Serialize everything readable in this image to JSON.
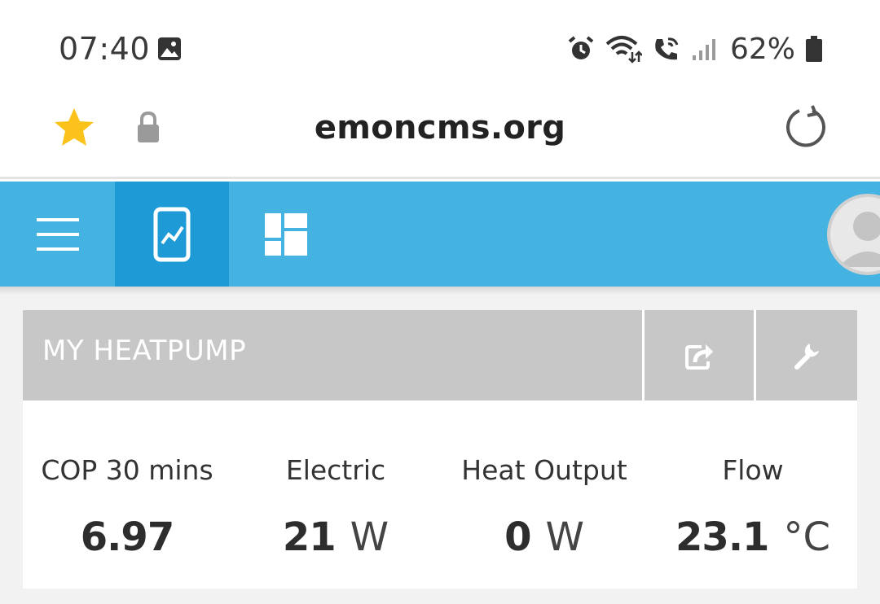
{
  "status_bar": {
    "time": "07:40",
    "battery_percent": "62%",
    "icons": [
      "gallery-icon",
      "alarm-icon",
      "wifi-icon",
      "wifi-call-icon",
      "signal-icon",
      "battery-icon"
    ]
  },
  "browser": {
    "url": "emoncms.org",
    "icons": [
      "star-icon",
      "lock-icon",
      "reload-icon"
    ]
  },
  "app_nav": {
    "icons": [
      "hamburger-menu-icon",
      "graph-icon",
      "dashboard-icon",
      "user-avatar-icon"
    ],
    "active": "graph",
    "colors": {
      "bar": "#44b3e2",
      "active": "#1e9bd7"
    }
  },
  "panel": {
    "title": "MY HEATPUMP",
    "header_color": "#c7c7c7",
    "actions": [
      "share-icon",
      "wrench-icon"
    ],
    "metrics": [
      {
        "label": "COP 30 mins",
        "value": "6.97",
        "unit": ""
      },
      {
        "label": "Electric",
        "value": "21",
        "unit": "W"
      },
      {
        "label": "Heat Output",
        "value": "0",
        "unit": "W"
      },
      {
        "label": "Flow",
        "value": "23.1",
        "unit": "°C"
      }
    ]
  }
}
